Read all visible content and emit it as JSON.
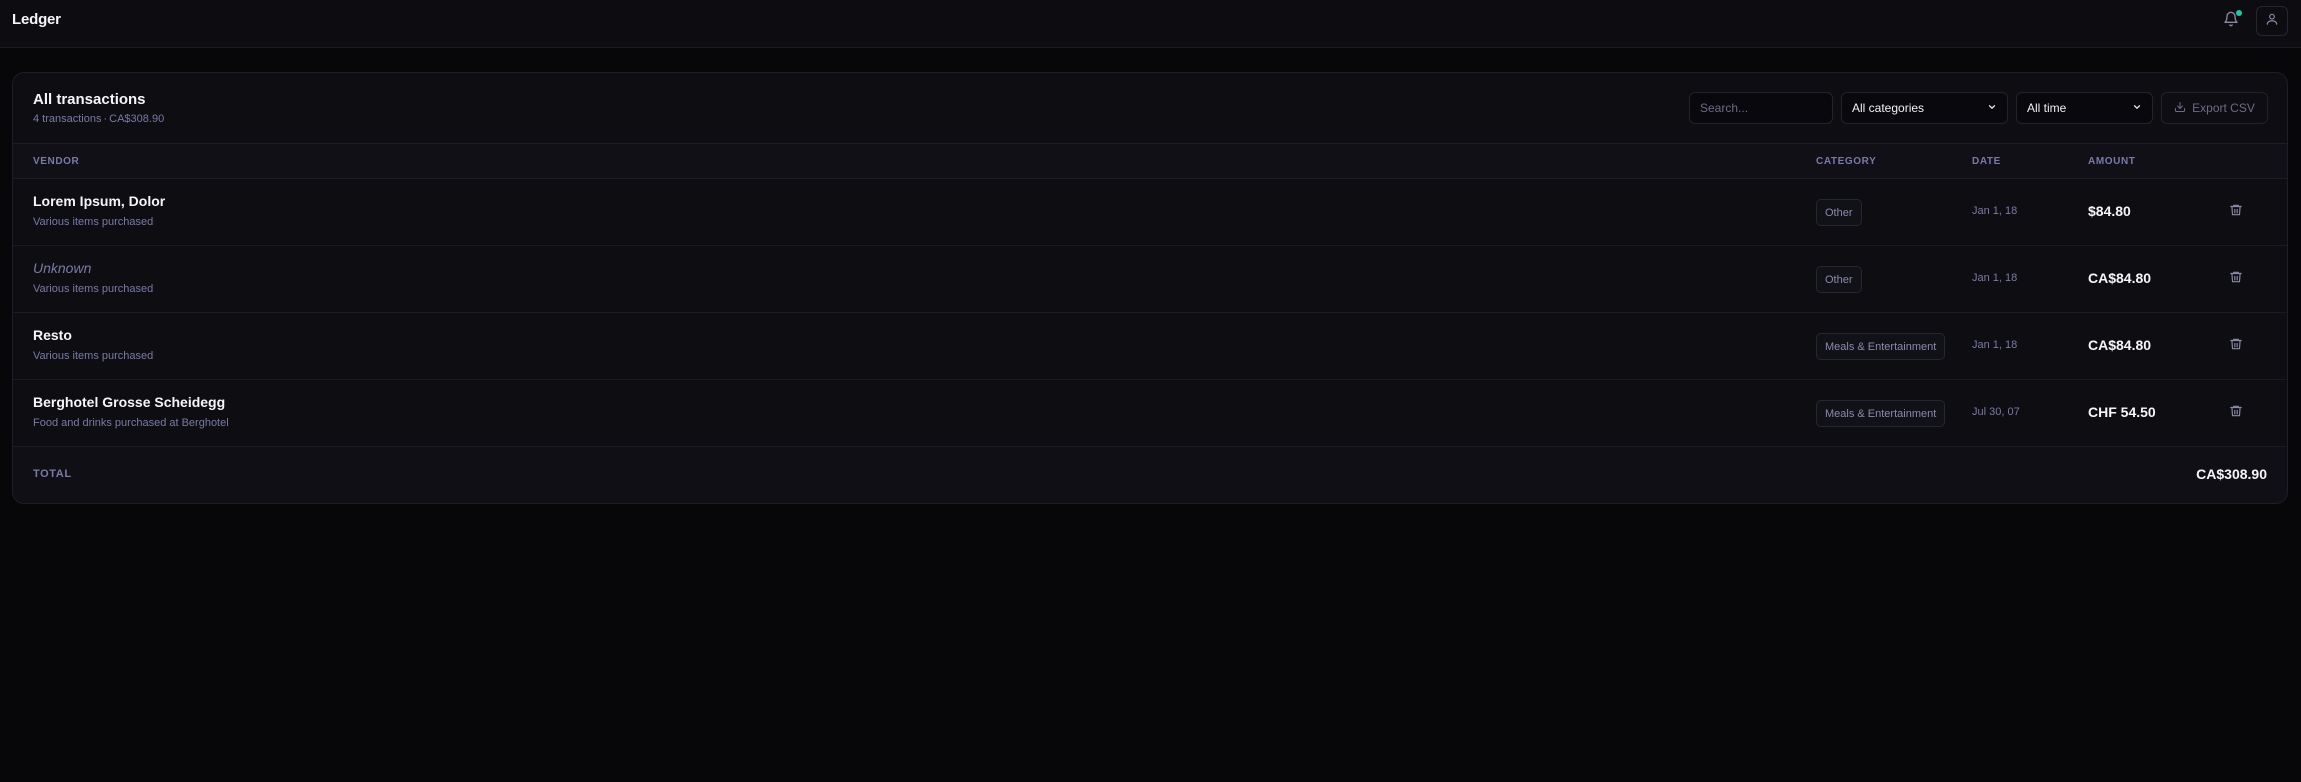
{
  "app": {
    "title": "Ledger"
  },
  "header": {
    "notification_icon": "bell-icon",
    "profile_icon": "user-icon",
    "accent": "#22c7a6"
  },
  "panel": {
    "title": "All transactions",
    "count_text": "4 transactions",
    "separator": "·",
    "total_text": "CA$308.90"
  },
  "filters": {
    "search_placeholder": "Search...",
    "search_value": "",
    "category_selected": "All categories",
    "time_selected": "All time",
    "export_label": "Export CSV"
  },
  "table": {
    "columns": {
      "vendor": "VENDOR",
      "category": "CATEGORY",
      "date": "DATE",
      "amount": "AMOUNT"
    },
    "rows": [
      {
        "vendor": "Lorem Ipsum, Dolor",
        "description": "Various items purchased",
        "category": "Other",
        "date": "Jan 1, 18",
        "amount": "$84.80"
      },
      {
        "vendor": "Unknown",
        "description": "Various items purchased",
        "category": "Other",
        "date": "Jan 1, 18",
        "amount": "CA$84.80"
      },
      {
        "vendor": "Resto",
        "description": "Various items purchased",
        "category": "Meals & Entertainment",
        "date": "Jan 1, 18",
        "amount": "CA$84.80"
      },
      {
        "vendor": "Berghotel Grosse Scheidegg",
        "description": "Food and drinks purchased at Berghotel",
        "category": "Meals & Entertainment",
        "date": "Jul 30, 07",
        "amount": "CHF 54.50"
      }
    ],
    "footer": {
      "label": "TOTAL",
      "value": "CA$308.90"
    }
  }
}
